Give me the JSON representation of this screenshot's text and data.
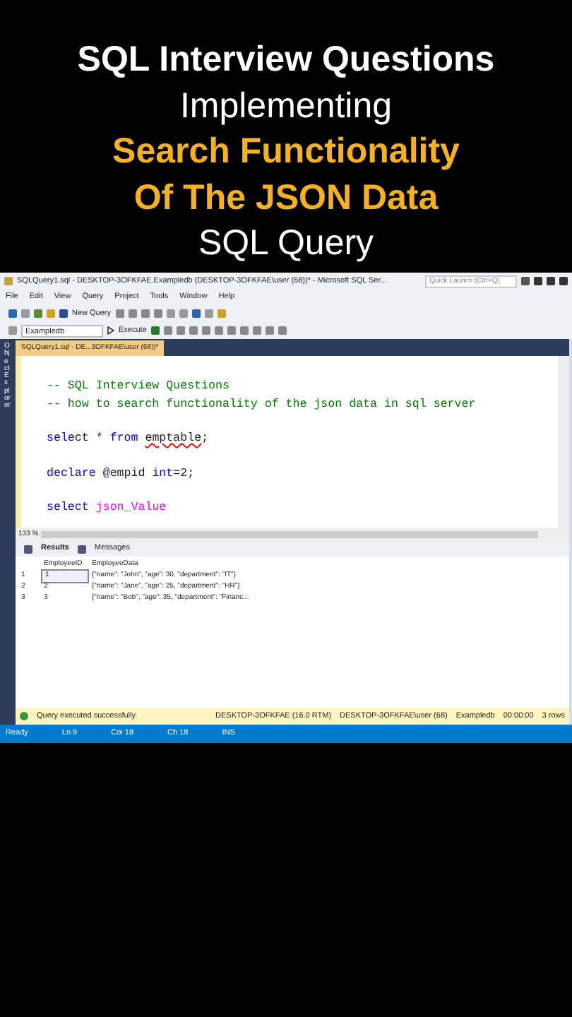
{
  "headline": [
    {
      "text": "SQL Interview Questions",
      "kind": "bold"
    },
    {
      "text": "Implementing",
      "kind": "plain"
    },
    {
      "text": "Search Functionality",
      "kind": "highlight"
    },
    {
      "text": "Of The JSON Data",
      "kind": "highlight"
    },
    {
      "text": "SQL Query",
      "kind": "plain"
    }
  ],
  "window": {
    "title": "SQLQuery1.sql - DESKTOP-3OFKFAE.Exampledb (DESKTOP-3OFKFAE\\user (68))* - Microsoft SQL Ser...",
    "quick_launch": {
      "placeholder": "Quick Launch (Ctrl+Q)"
    }
  },
  "menu": [
    "File",
    "Edit",
    "View",
    "Query",
    "Project",
    "Tools",
    "Window",
    "Help"
  ],
  "toolbar": {
    "new_query": "New Query",
    "database": "Exampledb",
    "execute": "Execute"
  },
  "side_panel": "Object Explorer",
  "tabs": [
    {
      "label": "SQLQuery1.sql - DE...3OFKFAE\\user (68))*",
      "selected": true
    }
  ],
  "editor": {
    "lines": [
      {
        "blank_before": true,
        "tokens": [
          {
            "text": "-- SQL Interview Questions",
            "kind": "comment"
          }
        ]
      },
      {
        "blank_before": false,
        "tokens": [
          {
            "text": "-- how to search functionality of the json data in sql server",
            "kind": "comment"
          }
        ]
      },
      {
        "blank_before": true,
        "tokens": [
          {
            "text": "select",
            "kind": "keyword"
          },
          {
            "text": " * ",
            "kind": "plain"
          },
          {
            "text": "from ",
            "kind": "keyword"
          },
          {
            "text": "emptable",
            "kind": "error"
          },
          {
            "text": ";",
            "kind": "plain"
          }
        ]
      },
      {
        "blank_before": true,
        "tokens": [
          {
            "text": "declare",
            "kind": "keyword"
          },
          {
            "text": " @empid ",
            "kind": "plain"
          },
          {
            "text": "int",
            "kind": "keyword"
          },
          {
            "text": "=2;",
            "kind": "plain"
          }
        ]
      },
      {
        "blank_before": true,
        "tokens": [
          {
            "text": "select ",
            "kind": "keyword"
          },
          {
            "text": "json_Value",
            "kind": "function"
          }
        ]
      }
    ],
    "zoom": "133 %"
  },
  "result_tabs": [
    {
      "label": "Results",
      "selected": true
    },
    {
      "label": "Messages",
      "selected": false
    }
  ],
  "table": {
    "columns": [
      "EmployeeID",
      "EmployeeData"
    ],
    "rows": [
      {
        "number": "1",
        "cells": [
          "1",
          "{\"name\": \"John\", \"age\": 30, \"department\": \"IT\"}"
        ],
        "selected": true
      },
      {
        "number": "2",
        "cells": [
          "2",
          "{\"name\": \"Jane\", \"age\": 25, \"department\": \"HR\"}"
        ],
        "selected": false
      },
      {
        "number": "3",
        "cells": [
          "3",
          "{\"name\": \"Bob\", \"age\": 35, \"department\": \"Financ..."
        ],
        "selected": false
      }
    ]
  },
  "query_status": {
    "message": "Query executed successfully.",
    "server": "DESKTOP-3OFKFAE (16.0 RTM)",
    "user": "DESKTOP-3OFKFAE\\user (68)",
    "database": "Exampledb",
    "time": "00:00:00",
    "rows": "3 rows"
  },
  "status_bar": [
    "Ready",
    "Ln 9",
    "Col 18",
    "Ch 18",
    "INS"
  ]
}
